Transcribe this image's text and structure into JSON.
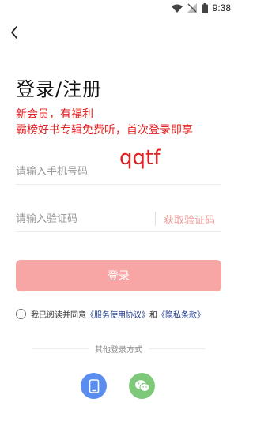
{
  "status": {
    "time": "9:38"
  },
  "page": {
    "title": "登录/注册",
    "promo_line1": "新会员，有福利",
    "promo_line2": "霸榜好书专辑免费听，首次登录即享",
    "captcha_text": "qqtf"
  },
  "form": {
    "phone_placeholder": "请输入手机号码",
    "code_placeholder": "请输入验证码",
    "get_code_label": "获取验证码",
    "login_label": "登录"
  },
  "agreement": {
    "prefix": "我已阅读并同意",
    "service": "《服务使用协议》",
    "and": "和",
    "privacy": "《隐私条款》"
  },
  "other_login": {
    "label": "其他登录方式",
    "icons": [
      "phone-icon",
      "wechat-icon"
    ]
  },
  "colors": {
    "accent": "#f8a5a5",
    "promo": "#e02020",
    "link": "#1e3a8a"
  }
}
